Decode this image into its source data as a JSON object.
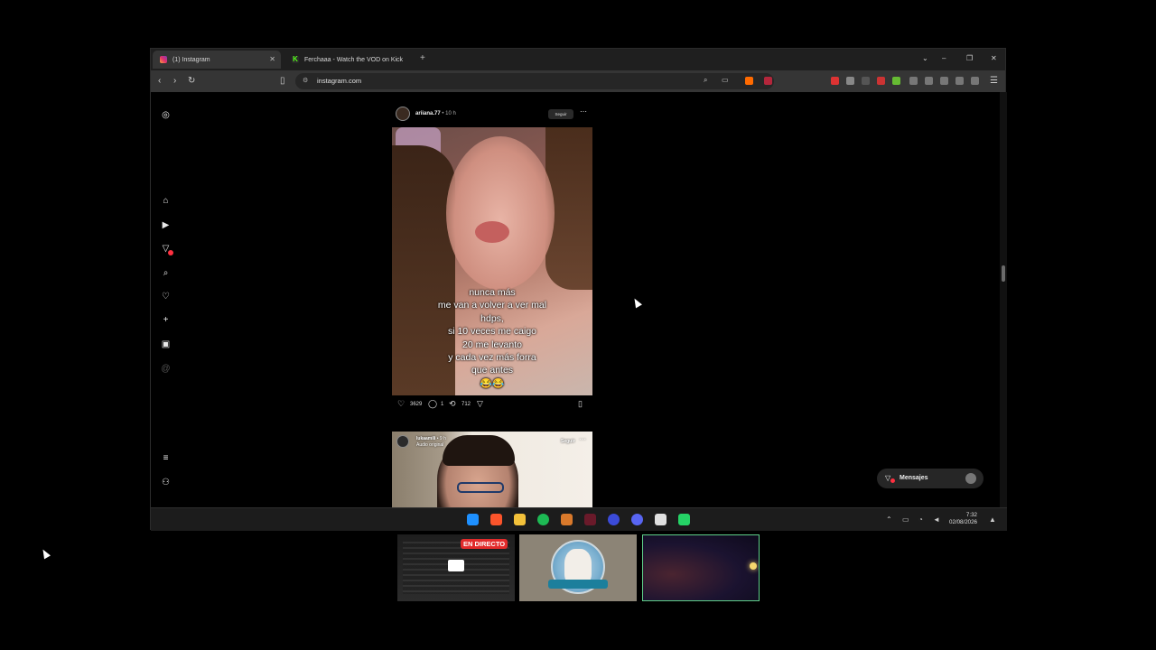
{
  "browser": {
    "tabs": [
      {
        "label": "(1) Instagram",
        "active": true
      },
      {
        "label": "Ferchaaa - Watch the VOD on Kick",
        "active": false
      }
    ],
    "url": "instagram.com"
  },
  "feed": {
    "post1": {
      "username": "ariiana.77",
      "time": "• 10 h",
      "follow_label": "Seguir",
      "caption": "nunca más\nme van a volver a ver mal\nhdps,\nsi 10 veces me caigo\n20 me levanto\ny cada vez más forra\nque antes\n😂😂",
      "likes": "3629",
      "comments": "1",
      "reposts": "712"
    },
    "post2": {
      "username": "lukaamili",
      "time": "• 9 h",
      "audio": "Audio original",
      "follow_label": "Seguir"
    }
  },
  "messages": {
    "label": "Mensajes"
  },
  "taskbar": {
    "time": "7:32",
    "date": "02/08/2026"
  },
  "stream": {
    "live_label": "EN DIRECTO"
  },
  "colors": {
    "accent": "#ff3040",
    "live": "#e22b2b",
    "cam_border": "#5fd08a"
  }
}
